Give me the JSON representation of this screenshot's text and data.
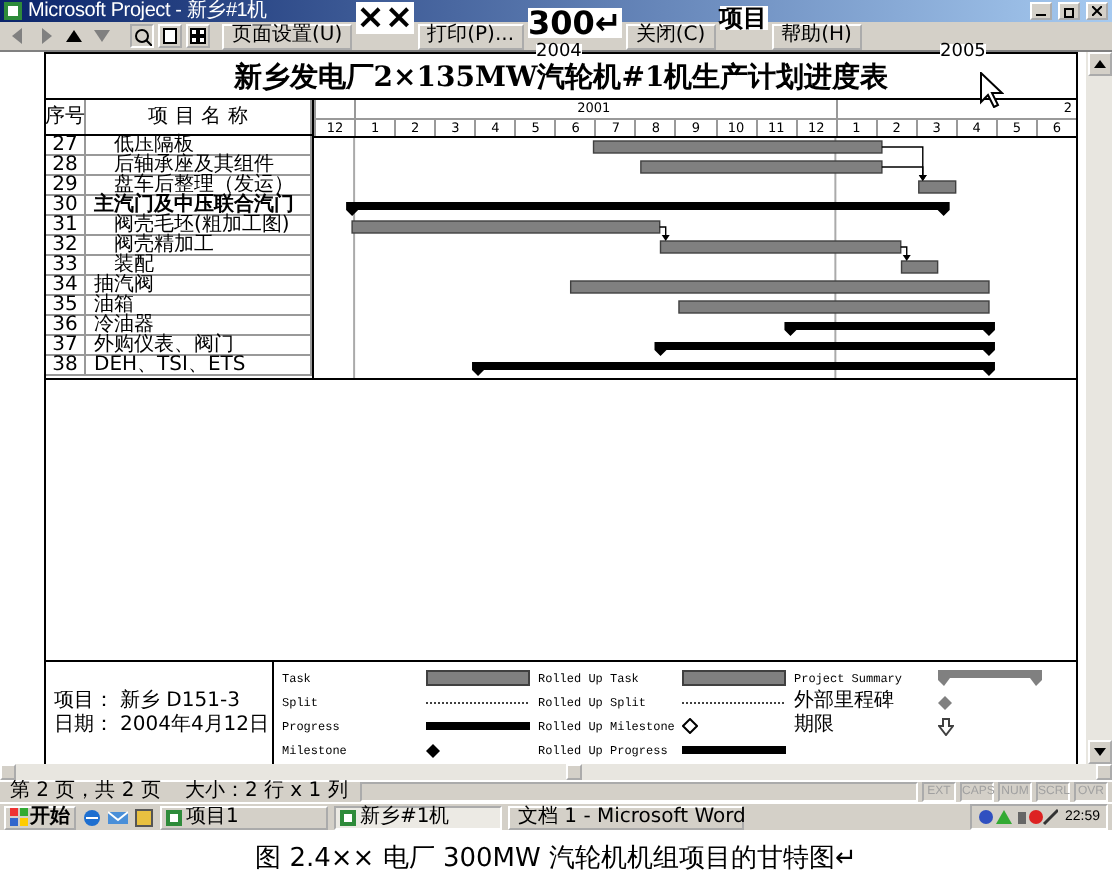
{
  "window": {
    "title": "Microsoft Project - 新乡#1机"
  },
  "toolbar": {
    "nav": [
      {
        "kind": "prev",
        "disabled": true
      },
      {
        "kind": "next",
        "disabled": true
      },
      {
        "kind": "up",
        "disabled": false
      },
      {
        "kind": "down",
        "disabled": true
      }
    ],
    "views": [
      {
        "kind": "zoom"
      },
      {
        "kind": "one_page"
      },
      {
        "kind": "multi_page"
      }
    ],
    "buttons": [
      "页面设置(U)",
      "打印(P)...",
      "关闭(C)",
      "帮助(H)"
    ]
  },
  "overlay_texts": [
    {
      "kind": "large",
      "text": "××"
    },
    {
      "kind": "medium",
      "text": "300↵"
    },
    {
      "kind": "small",
      "text": "项目"
    },
    {
      "kind": "year",
      "text": "2004"
    },
    {
      "kind": "year",
      "text": "2005"
    }
  ],
  "chart_title": "新乡发电厂2×135MW汽轮机#1机生产计划进度表",
  "table": {
    "columns": [
      "序号",
      "项 目 名 称"
    ]
  },
  "timescale": {
    "years": [
      "2001",
      "2"
    ],
    "months": [
      "12",
      "1",
      "2",
      "3",
      "4",
      "5",
      "6",
      "7",
      "8",
      "9",
      "10",
      "11",
      "12",
      "1",
      "2",
      "3",
      "4",
      "5",
      "6"
    ]
  },
  "tasks": [
    {
      "kind": "continuation",
      "children": [
        {
          "id": "27",
          "name": "低压隔板",
          "kind": "task"
        },
        {
          "id": "28",
          "name": "后轴承座及其组件",
          "kind": "task"
        },
        {
          "id": "29",
          "name": "盘车后整理（发运）",
          "kind": "task"
        }
      ]
    },
    {
      "id": "30",
      "name": "主汽门及中压联合汽门",
      "kind": "summary",
      "children": [
        {
          "id": "31",
          "name": "阀壳毛坯(粗加工图)",
          "kind": "task"
        },
        {
          "id": "32",
          "name": "阀壳精加工",
          "kind": "task"
        },
        {
          "id": "33",
          "name": "装配",
          "kind": "task"
        }
      ]
    },
    {
      "id": "34",
      "name": "抽汽阀",
      "kind": "task"
    },
    {
      "id": "35",
      "name": "油箱",
      "kind": "task"
    },
    {
      "id": "36",
      "name": "冷油器",
      "kind": "summary"
    },
    {
      "id": "37",
      "name": "外购仪表、阀门",
      "kind": "summary"
    },
    {
      "id": "38",
      "name": "DEH、TSI、ETS",
      "kind": "summary"
    }
  ],
  "legend": {
    "project": {
      "label": "项目：",
      "value": "新乡 D151-3"
    },
    "date": {
      "label": "日期：",
      "value": "2004年4月12日"
    },
    "items": [
      {
        "kind": "task",
        "label": "Task"
      },
      {
        "kind": "split",
        "label": "Split"
      },
      {
        "kind": "progress",
        "label": "Progress"
      },
      {
        "kind": "milestone",
        "label": "Milestone"
      },
      {
        "kind": "rolled_task",
        "label": "Rolled Up Task"
      },
      {
        "kind": "rolled_split",
        "label": "Rolled Up Split"
      },
      {
        "kind": "rolled_milestone",
        "label": "Rolled Up Milestone"
      },
      {
        "kind": "rolled_progress",
        "label": "Rolled Up Progress"
      },
      {
        "kind": "summary",
        "label": "Project Summary"
      },
      {
        "kind": "external_milestone",
        "label": "外部里程碑"
      },
      {
        "kind": "deadline",
        "label": "期限"
      }
    ]
  },
  "status_bar": {
    "page": "第 2 页，共 2 页",
    "size": "大小：2 行 x 1 列",
    "indicators": [
      {
        "label": "EXT",
        "on": false
      },
      {
        "label": "CAPS",
        "on": false
      },
      {
        "label": "NUM",
        "on": false
      },
      {
        "label": "SCRL",
        "on": false
      },
      {
        "label": "OVR",
        "on": false
      }
    ]
  },
  "taskbar": {
    "start": "开始",
    "tasks": [
      {
        "label": "项目1",
        "kind": "project",
        "selected": false
      },
      {
        "label": "新乡#1机",
        "kind": "project",
        "selected": true
      },
      {
        "label": "文档 1 - Microsoft Word",
        "kind": "word",
        "selected": false
      }
    ],
    "clock": "22:59"
  },
  "caption": "图 2.4×× 电厂 300MW 汽轮机机组项目的甘特图↵"
}
